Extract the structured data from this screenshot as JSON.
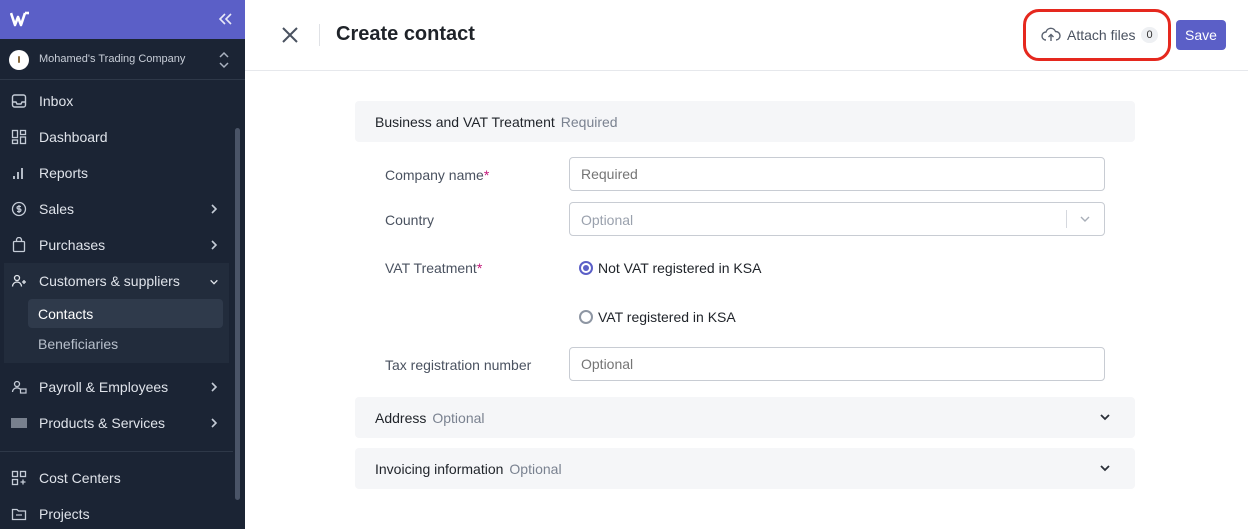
{
  "sidebar": {
    "company_name": "Mohamed's Trading Company",
    "items": [
      {
        "label": "Inbox",
        "icon": "inbox-icon"
      },
      {
        "label": "Dashboard",
        "icon": "dashboard-icon"
      },
      {
        "label": "Reports",
        "icon": "bar-chart-icon"
      },
      {
        "label": "Sales",
        "icon": "dollar-circle-icon"
      },
      {
        "label": "Purchases",
        "icon": "shopping-bag-icon"
      },
      {
        "label": "Customers & suppliers",
        "icon": "users-icon"
      },
      {
        "label": "Payroll & Employees",
        "icon": "payroll-icon"
      },
      {
        "label": "Products & Services",
        "icon": "barcode-icon"
      },
      {
        "label": "Cost Centers",
        "icon": "cost-centers-icon"
      },
      {
        "label": "Projects",
        "icon": "folder-icon"
      }
    ],
    "sub_items": [
      {
        "label": "Contacts"
      },
      {
        "label": "Beneficiaries"
      }
    ]
  },
  "header": {
    "title": "Create contact",
    "attach_label": "Attach files",
    "attach_count": "0",
    "save_label": "Save"
  },
  "form": {
    "section_business": {
      "title": "Business and VAT Treatment",
      "tag": "Required"
    },
    "company_name": {
      "label": "Company name",
      "required_mark": "*",
      "placeholder": "Required"
    },
    "country": {
      "label": "Country",
      "placeholder": "Optional"
    },
    "vat_treatment": {
      "label": "VAT Treatment",
      "required_mark": "*",
      "options": [
        "Not VAT registered in KSA",
        "VAT registered in KSA"
      ],
      "selected": "Not VAT registered in KSA"
    },
    "tax_number": {
      "label": "Tax registration number",
      "placeholder": "Optional"
    },
    "section_address": {
      "title": "Address",
      "tag": "Optional"
    },
    "section_invoicing": {
      "title": "Invoicing information",
      "tag": "Optional"
    }
  },
  "colors": {
    "accent": "#5b5fc7",
    "sidebar_bg": "#1b2434",
    "highlight": "#e5281e",
    "required": "#c2187a"
  }
}
